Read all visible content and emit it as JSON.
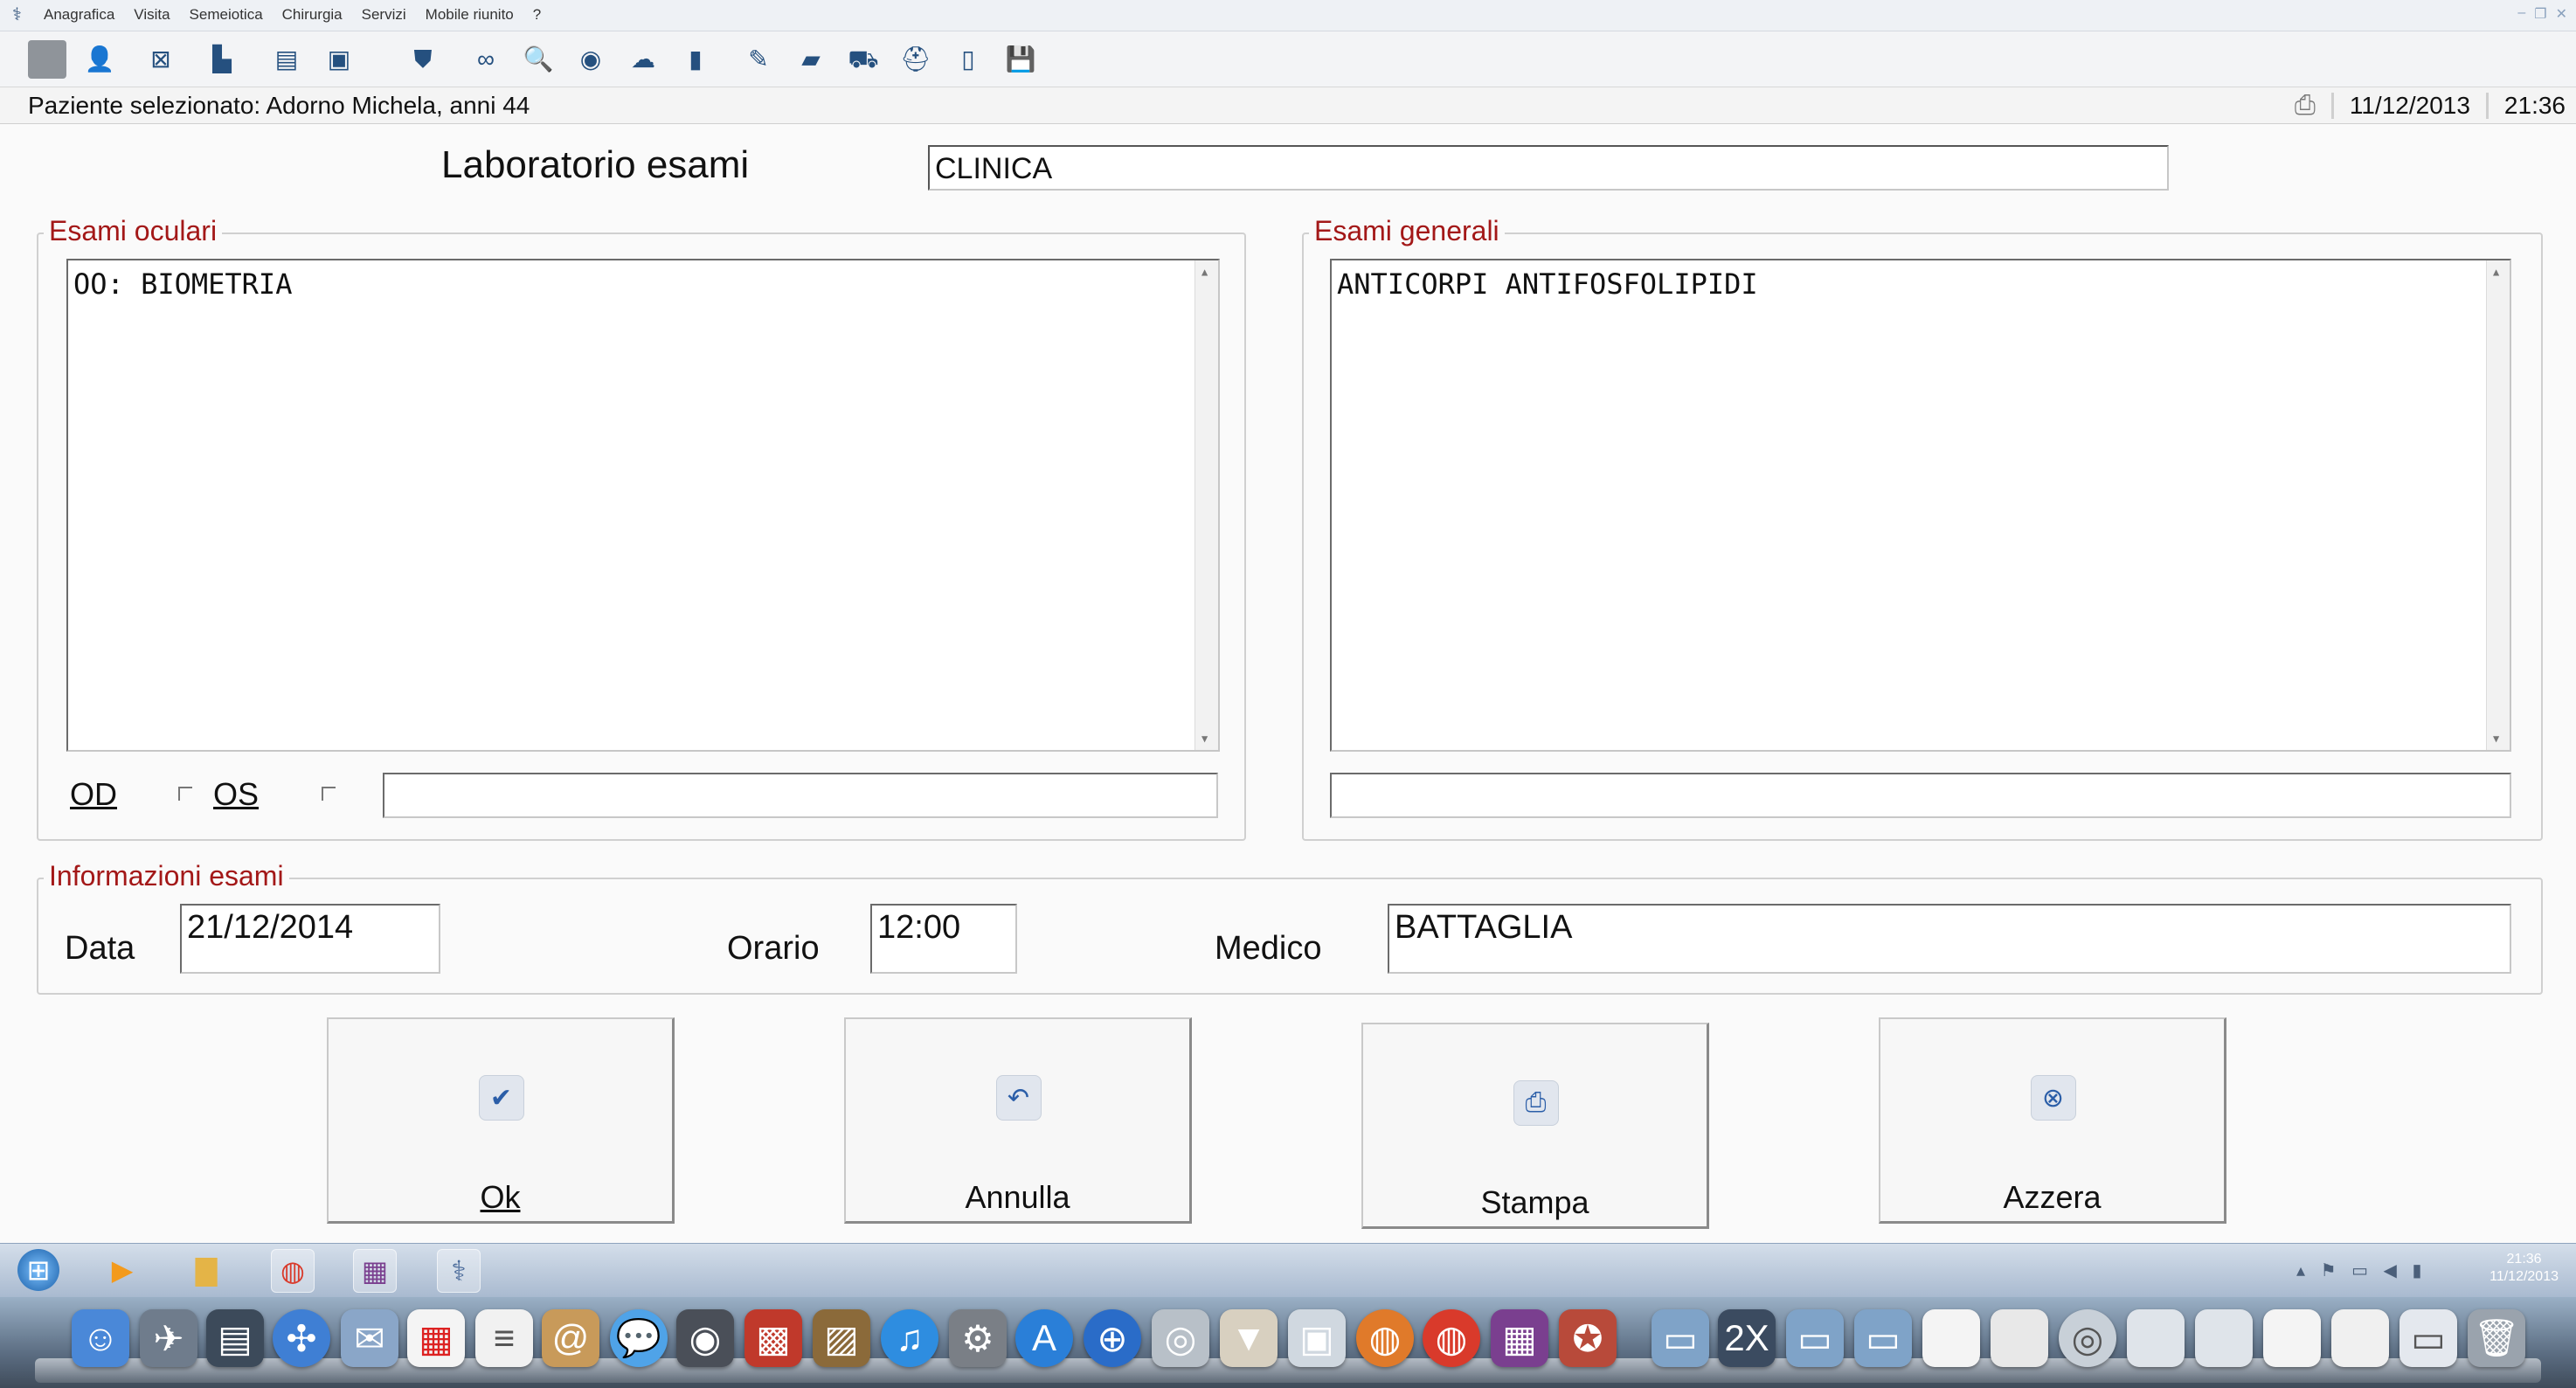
{
  "menu": {
    "items": [
      "Anagrafica",
      "Visita",
      "Semeiotica",
      "Chirurgia",
      "Servizi",
      "Mobile riunito",
      "?"
    ]
  },
  "toolbar": {
    "icons": [
      "blank",
      "user-icon",
      "close-box-icon",
      "folder-icon",
      "list-icon",
      "card-icon",
      "stamp-icon",
      "glasses-icon",
      "magnifier-icon",
      "eye-icon",
      "cloud-icon",
      "clipboard-icon",
      "pencil-icon",
      "book-icon",
      "car-icon",
      "bag-icon",
      "document-icon",
      "save-icon"
    ]
  },
  "status": {
    "patient": "Paziente selezionato: Adorno Michela, anni 44",
    "date": "11/12/2013",
    "time": "21:36"
  },
  "form": {
    "title": "Laboratorio esami",
    "clinica_value": "CLINICA",
    "esami_oculari": {
      "title": "Esami oculari",
      "value": "OO: BIOMETRIA",
      "od_label": "OD",
      "os_label": "OS",
      "note_value": ""
    },
    "esami_generali": {
      "title": "Esami generali",
      "value": "ANTICORPI ANTIFOSFOLIPIDI",
      "note_value": ""
    },
    "informazioni": {
      "title": "Informazioni esami",
      "data_label": "Data",
      "data_value": "21/12/2014",
      "orario_label": "Orario",
      "orario_value": "12:00",
      "medico_label": "Medico",
      "medico_value": "BATTAGLIA"
    },
    "buttons": {
      "ok": "Ok",
      "annulla": "Annulla",
      "stampa": "Stampa",
      "azzera": "Azzera"
    }
  },
  "taskbar": {
    "clock_time": "21:36",
    "clock_date": "11/12/2013"
  },
  "colors": {
    "group_title": "#a31818",
    "toolbar_icon": "#25507f"
  }
}
